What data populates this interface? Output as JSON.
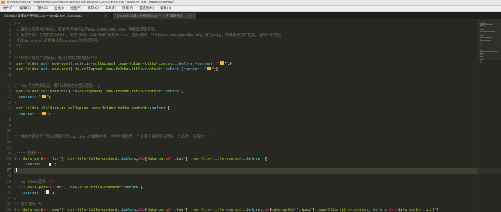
{
  "window": {
    "title": "D:\\OneDrive\\TW Folder\\Project\\All\\Folder\\Seel\\project\\Folder\\Config\\Style.css - Sublime Text (UNREGISTERED)"
  },
  "menu": [
    "文件(F)",
    "编辑(E)",
    "选择(S)",
    "查找(I)",
    "视图(V)",
    "跳转(G)",
    "工具(T)",
    "项目(P)",
    "首选项(N)",
    "帮助(H)"
  ],
  "tabs": [
    {
      "label": "Obsidian设置文件夹图标.css — OneDrive\\...\\snippets",
      "active": true
    },
    {
      "label": "Obsidian设置文件夹图标.css — 文件_日期格式",
      "active": false
    }
  ],
  "icons": {
    "folder": "folder-icon",
    "file": "file-icon",
    "close": "close-icon"
  },
  "colors": {
    "background": "#272822",
    "comment": "#75715e",
    "string": "#e6db74",
    "keyword": "#f92672",
    "attribute": "#a6e22e",
    "function": "#66d9ef",
    "folder": "#f0b63a"
  },
  "editor": {
    "current_line": 27,
    "lines": [
      {
        "n": 1,
        "segs": [
          {
            "t": "/**",
            "c": "c"
          }
        ]
      },
      {
        "n": 2,
        "segs": [
          {
            "t": " 1.推动自调原标的样式，有编号理参可访问www.yunglobe.com，遇器旗值等系修。",
            "c": "c"
          }
        ]
      },
      {
        "n": 3,
        "segs": [
          {
            "t": " 2.配置方法：在侧内保存用于，设置-外观-高级代码片段代码\"css，图标请到：\"https://emojipedia.org 进行copy，同理其他文件格式，复制一份相应",
            "c": "c"
          }
        ]
      },
      {
        "n": 4,
        "segs": [
          {
            "t": " 修改data-path后面格式和content的样式即可。",
            "c": "c"
          }
        ]
      },
      {
        "n": 5,
        "segs": [
          {
            "t": " **/",
            "c": "c"
          }
        ]
      },
      {
        "n": 6,
        "segs": []
      },
      {
        "n": 7,
        "segs": [
          {
            "t": "/**制切一级文件夹链起，展开2种状态的图标**/",
            "c": "c"
          }
        ]
      },
      {
        "n": 8,
        "segs": [
          {
            "t": ".nav-folder",
            "c": "a"
          },
          {
            "t": ":not",
            "c": "f"
          },
          {
            "t": "(",
            "c": "p"
          },
          {
            "t": ".mod-root",
            "c": "a"
          },
          {
            "t": "):not",
            "c": "f"
          },
          {
            "t": "(",
            "c": "p"
          },
          {
            "t": ".is-collapsed",
            "c": "a"
          },
          {
            "t": ") ",
            "c": "p"
          },
          {
            "t": ".nav-folder-title-content",
            "c": "a"
          },
          {
            "t": "::before",
            "c": "f"
          },
          {
            "t": " {",
            "c": "p"
          },
          {
            "t": "content",
            "c": "f"
          },
          {
            "t": ": ",
            "c": "p"
          },
          {
            "t": "\"",
            "c": "s"
          },
          {
            "t": "@folder",
            "c": "i"
          },
          {
            "t": "\"",
            "c": "s"
          },
          {
            "t": ";}",
            "c": "p"
          }
        ]
      },
      {
        "n": 9,
        "segs": [
          {
            "t": ".nav-folder",
            "c": "a"
          },
          {
            "t": ":not",
            "c": "f"
          },
          {
            "t": "(",
            "c": "p"
          },
          {
            "t": ".mod-root",
            "c": "a"
          },
          {
            "t": ")",
            "c": "p"
          },
          {
            "t": ".is-collapsed",
            "c": "a"
          },
          {
            "t": " ",
            "c": "p"
          },
          {
            "t": ".nav-folder-title-content",
            "c": "a"
          },
          {
            "t": "::before",
            "c": "f"
          },
          {
            "t": " {",
            "c": "p"
          },
          {
            "t": "content",
            "c": "f"
          },
          {
            "t": ": ",
            "c": "p"
          },
          {
            "t": "\"",
            "c": "s"
          },
          {
            "t": "@folder",
            "c": "i"
          },
          {
            "t": "\"",
            "c": "s"
          },
          {
            "t": ";}",
            "c": "p"
          }
        ]
      },
      {
        "n": 10,
        "segs": []
      },
      {
        "n": 11,
        "segs": []
      },
      {
        "n": 12,
        "segs": [
          {
            "t": "/* Sub子文件夹新起，展开2种状态的图标图标 */",
            "c": "c"
          }
        ]
      },
      {
        "n": 13,
        "segs": [
          {
            "t": ".nav-folder-children",
            "c": "a"
          },
          {
            "t": ":not",
            "c": "f"
          },
          {
            "t": "(",
            "c": "p"
          },
          {
            "t": ".is-collapsed",
            "c": "a"
          },
          {
            "t": ") ",
            "c": "p"
          },
          {
            "t": ".nav-folder-title-content",
            "c": "a"
          },
          {
            "t": "::before",
            "c": "f"
          },
          {
            "t": " {",
            "c": "p"
          }
        ]
      },
      {
        "n": 14,
        "segs": [
          {
            "t": "  content",
            "c": "f"
          },
          {
            "t": ": ",
            "c": "p"
          },
          {
            "t": "\"",
            "c": "s"
          },
          {
            "t": "@folder",
            "c": "i"
          },
          {
            "t": "\"",
            "c": "s"
          },
          {
            "t": ";",
            "c": "p"
          }
        ]
      },
      {
        "n": 15,
        "segs": [
          {
            "t": "}",
            "c": "p"
          }
        ]
      },
      {
        "n": 16,
        "segs": [
          {
            "t": ".nav-folder-children",
            "c": "a"
          },
          {
            "t": ".is-collapsed",
            "c": "a"
          },
          {
            "t": " ",
            "c": "p"
          },
          {
            "t": ".nav-folder-title-content",
            "c": "a"
          },
          {
            "t": "::before",
            "c": "f"
          },
          {
            "t": " {",
            "c": "p"
          }
        ]
      },
      {
        "n": 17,
        "segs": [
          {
            "t": "  content",
            "c": "f"
          },
          {
            "t": ": ",
            "c": "p"
          },
          {
            "t": "\"",
            "c": "s"
          },
          {
            "t": "@folder",
            "c": "i"
          },
          {
            "t": "\"",
            "c": "s"
          },
          {
            "t": ";",
            "c": "p"
          }
        ]
      },
      {
        "n": 18,
        "segs": [
          {
            "t": "}",
            "c": "p"
          }
        ]
      },
      {
        "n": 19,
        "segs": []
      },
      {
        "n": 20,
        "segs": []
      },
      {
        "n": 21,
        "segs": [
          {
            "t": "/**弹励在原修改了同上根据写的children选择器的类，这样在搜是思，子目录下都能显示图标，代码进一步简化**/",
            "c": "c"
          }
        ]
      },
      {
        "n": 22,
        "segs": []
      },
      {
        "n": 23,
        "segs": []
      },
      {
        "n": 24,
        "segs": [
          {
            "t": "/**txt图标**/",
            "c": "c"
          }
        ]
      },
      {
        "n": 25,
        "segs": [
          {
            "t": "div",
            "c": "k"
          },
          {
            "t": "[",
            "c": "p"
          },
          {
            "t": "data-path",
            "c": "a"
          },
          {
            "t": "$=",
            "c": "k"
          },
          {
            "t": "'.txt'",
            "c": "s"
          },
          {
            "t": "] ",
            "c": "p"
          },
          {
            "t": ".nav-file-title-content",
            "c": "a"
          },
          {
            "t": "::before",
            "c": "f"
          },
          {
            "t": ",",
            "c": "p"
          },
          {
            "t": "div",
            "c": "k"
          },
          {
            "t": "[",
            "c": "p"
          },
          {
            "t": "data-path",
            "c": "a"
          },
          {
            "t": "$=",
            "c": "k"
          },
          {
            "t": "'.ini'",
            "c": "s"
          },
          {
            "t": "] ",
            "c": "p"
          },
          {
            "t": ".nav-file-title-content",
            "c": "a"
          },
          {
            "t": "::before",
            "c": "f"
          },
          {
            "t": "  {",
            "c": "p"
          }
        ]
      },
      {
        "n": 26,
        "segs": [
          {
            "t": "     content",
            "c": "f"
          },
          {
            "t": ": ",
            "c": "p"
          },
          {
            "t": "'",
            "c": "s"
          },
          {
            "t": "@file",
            "c": "i"
          },
          {
            "t": "'",
            "c": "s"
          },
          {
            "t": ";",
            "c": "p"
          }
        ]
      },
      {
        "n": 27,
        "segs": [
          {
            "t": "}",
            "c": "p"
          },
          {
            "t": "@cursor",
            "c": "i"
          }
        ]
      },
      {
        "n": 28,
        "segs": []
      },
      {
        "n": 29,
        "segs": [
          {
            "t": "/* markdown图标 */",
            "c": "c"
          }
        ]
      },
      {
        "n": 30,
        "segs": [
          {
            "t": "  div",
            "c": "k"
          },
          {
            "t": "[",
            "c": "p"
          },
          {
            "t": "data-path",
            "c": "a"
          },
          {
            "t": "$=",
            "c": "k"
          },
          {
            "t": "'.md'",
            "c": "s"
          },
          {
            "t": "] ",
            "c": "p"
          },
          {
            "t": ".nav-file-title-content",
            "c": "a"
          },
          {
            "t": "::before",
            "c": "f"
          },
          {
            "t": " {",
            "c": "p"
          }
        ]
      },
      {
        "n": 31,
        "segs": [
          {
            "t": "    content",
            "c": "f"
          },
          {
            "t": ": ",
            "c": "p"
          },
          {
            "t": "'",
            "c": "s"
          },
          {
            "t": "@file",
            "c": "i"
          },
          {
            "t": "'",
            "c": "s"
          },
          {
            "t": ";",
            "c": "p"
          }
        ]
      },
      {
        "n": 32,
        "segs": [
          {
            "t": "}",
            "c": "p"
          }
        ]
      },
      {
        "n": 33,
        "segs": [
          {
            "t": "/* 图片图标 */",
            "c": "c"
          }
        ]
      },
      {
        "n": 34,
        "segs": [
          {
            "t": "div",
            "c": "k"
          },
          {
            "t": "[",
            "c": "p"
          },
          {
            "t": "data-path",
            "c": "a"
          },
          {
            "t": "$=",
            "c": "k"
          },
          {
            "t": "'.png'",
            "c": "s"
          },
          {
            "t": "] ",
            "c": "p"
          },
          {
            "t": ".nav-file-title-content",
            "c": "a"
          },
          {
            "t": "::before",
            "c": "f"
          },
          {
            "t": ",",
            "c": "p"
          },
          {
            "t": "div",
            "c": "k"
          },
          {
            "t": "[",
            "c": "p"
          },
          {
            "t": "data-path",
            "c": "a"
          },
          {
            "t": "$=",
            "c": "k"
          },
          {
            "t": "'.jpg'",
            "c": "s"
          },
          {
            "t": "] ",
            "c": "p"
          },
          {
            "t": ".nav-file-title-content",
            "c": "a"
          },
          {
            "t": "::before",
            "c": "f"
          },
          {
            "t": ",",
            "c": "p"
          },
          {
            "t": "div",
            "c": "k"
          },
          {
            "t": "[",
            "c": "p"
          },
          {
            "t": "data-path",
            "c": "a"
          },
          {
            "t": "$=",
            "c": "k"
          },
          {
            "t": "'.jpeg'",
            "c": "s"
          },
          {
            "t": "] ",
            "c": "p"
          },
          {
            "t": ".nav-file-title-content",
            "c": "a"
          },
          {
            "t": "::before",
            "c": "f"
          },
          {
            "t": ",",
            "c": "p"
          },
          {
            "t": "div",
            "c": "k"
          },
          {
            "t": "[",
            "c": "p"
          },
          {
            "t": "data-path",
            "c": "a"
          },
          {
            "t": "$=",
            "c": "k"
          },
          {
            "t": "'.gif'",
            "c": "s"
          },
          {
            "t": "]",
            "c": "p"
          }
        ]
      }
    ]
  }
}
